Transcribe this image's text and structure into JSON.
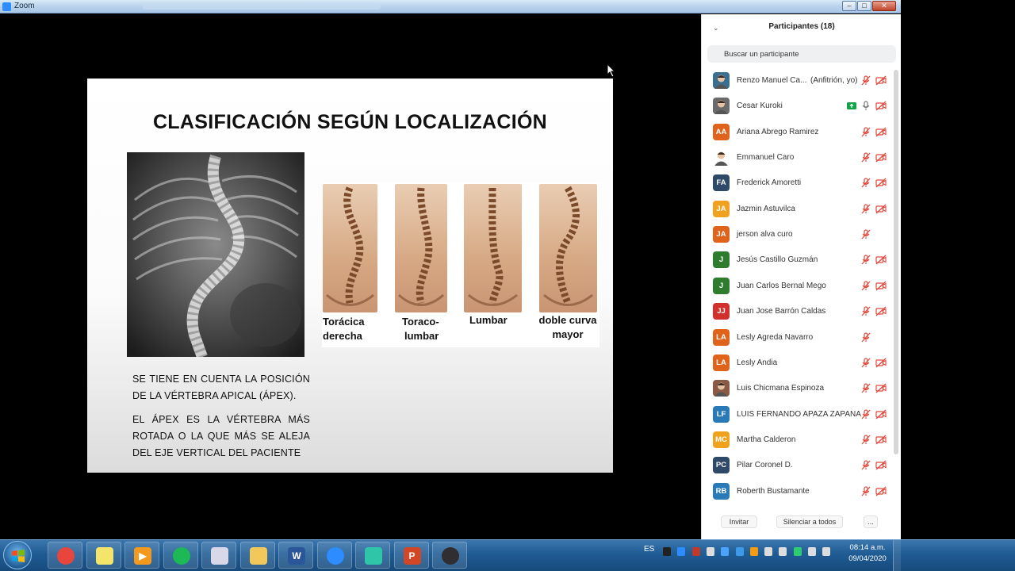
{
  "window": {
    "title": "Zoom"
  },
  "slide": {
    "title": "CLASIFICACIÓN SEGÚN LOCALIZACIÓN",
    "spine_labels": [
      {
        "line1": "Torácica",
        "line2": "derecha"
      },
      {
        "line1": "Toraco-",
        "line2": "lumbar"
      },
      {
        "line1": "Lumbar",
        "line2": ""
      },
      {
        "line1": "doble curva",
        "line2": "mayor"
      }
    ],
    "paragraph1": "SE TIENE EN CUENTA LA POSICIÓN DE LA VÉRTEBRA APICAL (ÁPEX).",
    "paragraph2": "EL ÁPEX ES LA VÉRTEBRA MÁS ROTADA O LA QUE MÁS SE ALEJA DEL EJE VERTICAL DEL PACIENTE"
  },
  "participants_panel": {
    "title": "Participantes (18)",
    "search_placeholder": "Buscar un participante",
    "participants": [
      {
        "name": "Renzo Manuel Ca...",
        "role": "(Anfitrión, yo)",
        "avatar": "",
        "avatar_color": "#3a6f8f",
        "mic": "muted",
        "video": "off",
        "photo": true
      },
      {
        "name": "Cesar Kuroki",
        "role": "",
        "avatar": "",
        "avatar_color": "#6b6b6b",
        "mic": "on",
        "video": "off",
        "share": true,
        "photo": true
      },
      {
        "name": "Ariana Abrego Ramirez",
        "role": "",
        "avatar": "AA",
        "avatar_color": "#e0631c",
        "mic": "muted",
        "video": "off"
      },
      {
        "name": "Emmanuel Caro",
        "role": "",
        "avatar": "",
        "avatar_color": "#ffffff",
        "mic": "muted",
        "video": "off",
        "photo": true
      },
      {
        "name": "Frederick Amoretti",
        "role": "",
        "avatar": "FA",
        "avatar_color": "#2f4a68",
        "mic": "muted",
        "video": "off"
      },
      {
        "name": "Jazmin Astuvilca",
        "role": "",
        "avatar": "JA",
        "avatar_color": "#f0a21e",
        "mic": "muted",
        "video": "off"
      },
      {
        "name": "jerson alva curo",
        "role": "",
        "avatar": "JA",
        "avatar_color": "#e0631c",
        "mic": "muted",
        "video": ""
      },
      {
        "name": "Jesús Castillo Guzmán",
        "role": "",
        "avatar": "J",
        "avatar_color": "#2e7d2e",
        "mic": "muted",
        "video": "off"
      },
      {
        "name": "Juan Carlos Bernal Mego",
        "role": "",
        "avatar": "J",
        "avatar_color": "#2e7d2e",
        "mic": "muted",
        "video": "off"
      },
      {
        "name": "Juan Jose Barrón Caldas",
        "role": "",
        "avatar": "JJ",
        "avatar_color": "#d0312d",
        "mic": "muted",
        "video": "off"
      },
      {
        "name": "Lesly Agreda Navarro",
        "role": "",
        "avatar": "LA",
        "avatar_color": "#e0631c",
        "mic": "muted",
        "video": ""
      },
      {
        "name": "Lesly Andia",
        "role": "",
        "avatar": "LA",
        "avatar_color": "#e0631c",
        "mic": "muted",
        "video": "off"
      },
      {
        "name": "Luis Chicmana Espinoza",
        "role": "",
        "avatar": "",
        "avatar_color": "#8a5a44",
        "mic": "muted",
        "video": "off",
        "photo": true
      },
      {
        "name": "LUIS FERNANDO APAZA ZAPANA",
        "role": "",
        "avatar": "LF",
        "avatar_color": "#2a7ab8",
        "mic": "muted",
        "video": "off"
      },
      {
        "name": "Martha Calderon",
        "role": "",
        "avatar": "MC",
        "avatar_color": "#f0a21e",
        "mic": "muted",
        "video": "off"
      },
      {
        "name": "Pilar Coronel D.",
        "role": "",
        "avatar": "PC",
        "avatar_color": "#2f4a68",
        "mic": "muted",
        "video": "off"
      },
      {
        "name": "Roberth Bustamante",
        "role": "",
        "avatar": "RB",
        "avatar_color": "#2a7ab8",
        "mic": "muted",
        "video": "off"
      }
    ],
    "footer": {
      "invite": "Invitar",
      "mute_all": "Silenciar a todos",
      "more": "..."
    }
  },
  "taskbar": {
    "apps": [
      "chrome-icon",
      "notes-icon",
      "media-player-icon",
      "spotify-icon",
      "paint-icon",
      "file-explorer-icon",
      "word-icon",
      "zoom-icon",
      "filmora-icon",
      "powerpoint-icon",
      "obs-icon"
    ],
    "language": "ES",
    "time": "08:14 a.m.",
    "date": "09/04/2020"
  }
}
